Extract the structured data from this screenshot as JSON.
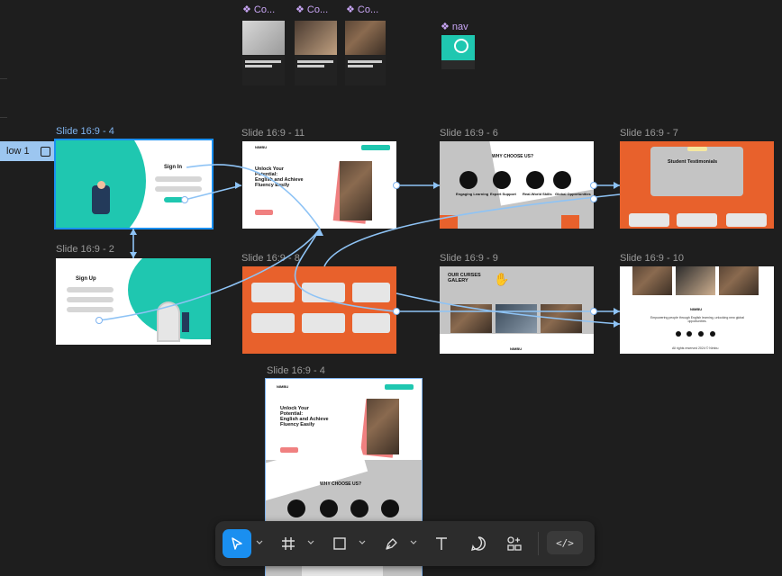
{
  "components": [
    {
      "label": "❖ Co..."
    },
    {
      "label": "❖ Co..."
    },
    {
      "label": "❖ Co..."
    }
  ],
  "nav_component": {
    "label": "❖ nav"
  },
  "flow": {
    "label": "low 1"
  },
  "frames": {
    "f4": {
      "label": "Slide 16:9 - 4",
      "sign_in": "Sign In"
    },
    "f2": {
      "label": "Slide 16:9 - 2",
      "sign_up": "Sign Up"
    },
    "f11": {
      "label": "Slide 16:9 - 11",
      "brand": "NIMBU",
      "hero_title_1": "Unlock Your",
      "hero_title_2": "Potential:",
      "hero_title_3": "English and Achieve",
      "hero_title_4": "Fluency Easily",
      "cta": "GET STARTED"
    },
    "f6": {
      "label": "Slide 16:9 - 6",
      "heading": "WHY CHOOSE US?",
      "features": [
        "Engaging Learning",
        "Expert Support",
        "Real-World Skills",
        "Global Opportunities"
      ]
    },
    "f7": {
      "label": "Slide 16:9 - 7",
      "heading": "Student Testimonials"
    },
    "f8": {
      "label": "Slide 16:9 - 8"
    },
    "f9": {
      "label": "Slide 16:9 - 9",
      "heading_1": "OUR CURSES",
      "heading_2": "GALERY",
      "brand": "NIMBU"
    },
    "f10": {
      "label": "Slide 16:9 - 10",
      "brand": "NIMBU",
      "tagline": "Empowering people through English learning, unlocking new global opportunities.",
      "copyright": "All rights reserved 2024 © Nimbu"
    },
    "f4b": {
      "label": "Slide 16:9 - 4",
      "brand": "NIMBU",
      "hero_title_1": "Unlock Your",
      "hero_title_2": "Potential:",
      "hero_title_3": "English and Achieve",
      "hero_title_4": "Fluency Easily",
      "section": "WHY CHOOSE US?"
    }
  },
  "toolbar": {
    "tools": [
      "move-tool",
      "frame-tool",
      "shape-tool",
      "pen-tool",
      "text-tool",
      "comment-tool",
      "actions-tool"
    ],
    "code_label": "</>"
  },
  "colors": {
    "accent": "#1a8ff0",
    "orange": "#e8612c",
    "teal": "#1fc7b0",
    "selection": "#7fb4f0",
    "component": "#c9a6f5"
  }
}
